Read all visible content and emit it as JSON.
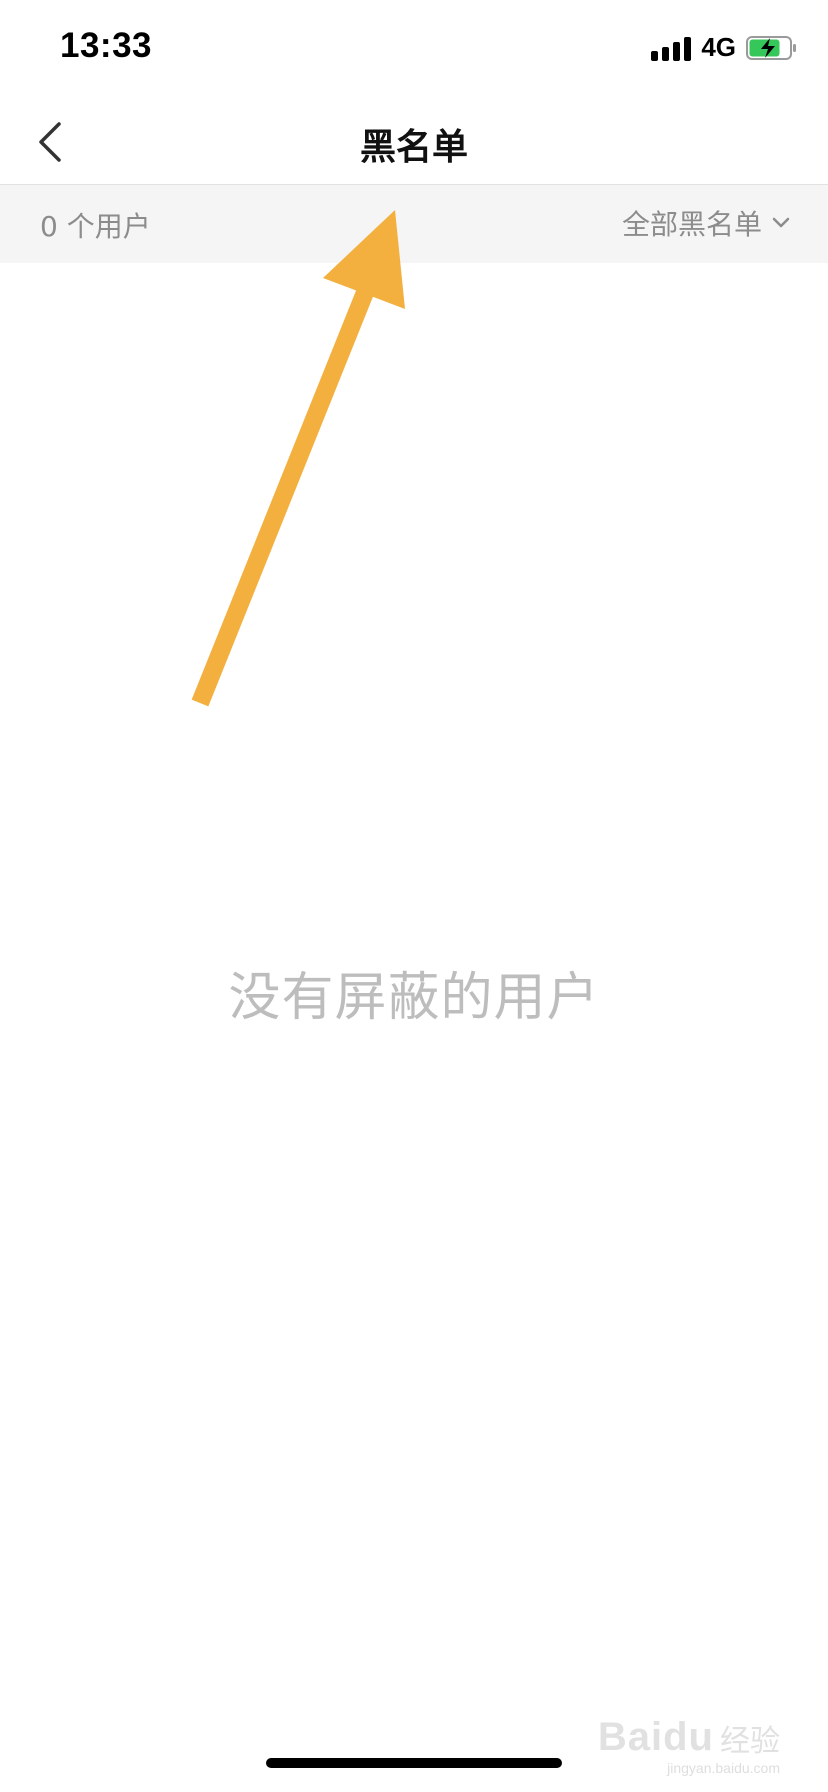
{
  "status_bar": {
    "time": "13:33",
    "network": "4G",
    "battery_color": "#35c759"
  },
  "nav": {
    "back_icon": "chevron-left-icon",
    "title": "黑名单"
  },
  "filter_bar": {
    "count_label": "0 个用户",
    "filter_label": "全部黑名单",
    "filter_icon": "chevron-down-icon"
  },
  "empty_state": {
    "message": "没有屏蔽的用户"
  },
  "annotation": {
    "type": "arrow",
    "color": "#f3b03f"
  },
  "watermark": {
    "brand": "Baidu",
    "suffix": "经验",
    "url": "jingyan.baidu.com"
  }
}
